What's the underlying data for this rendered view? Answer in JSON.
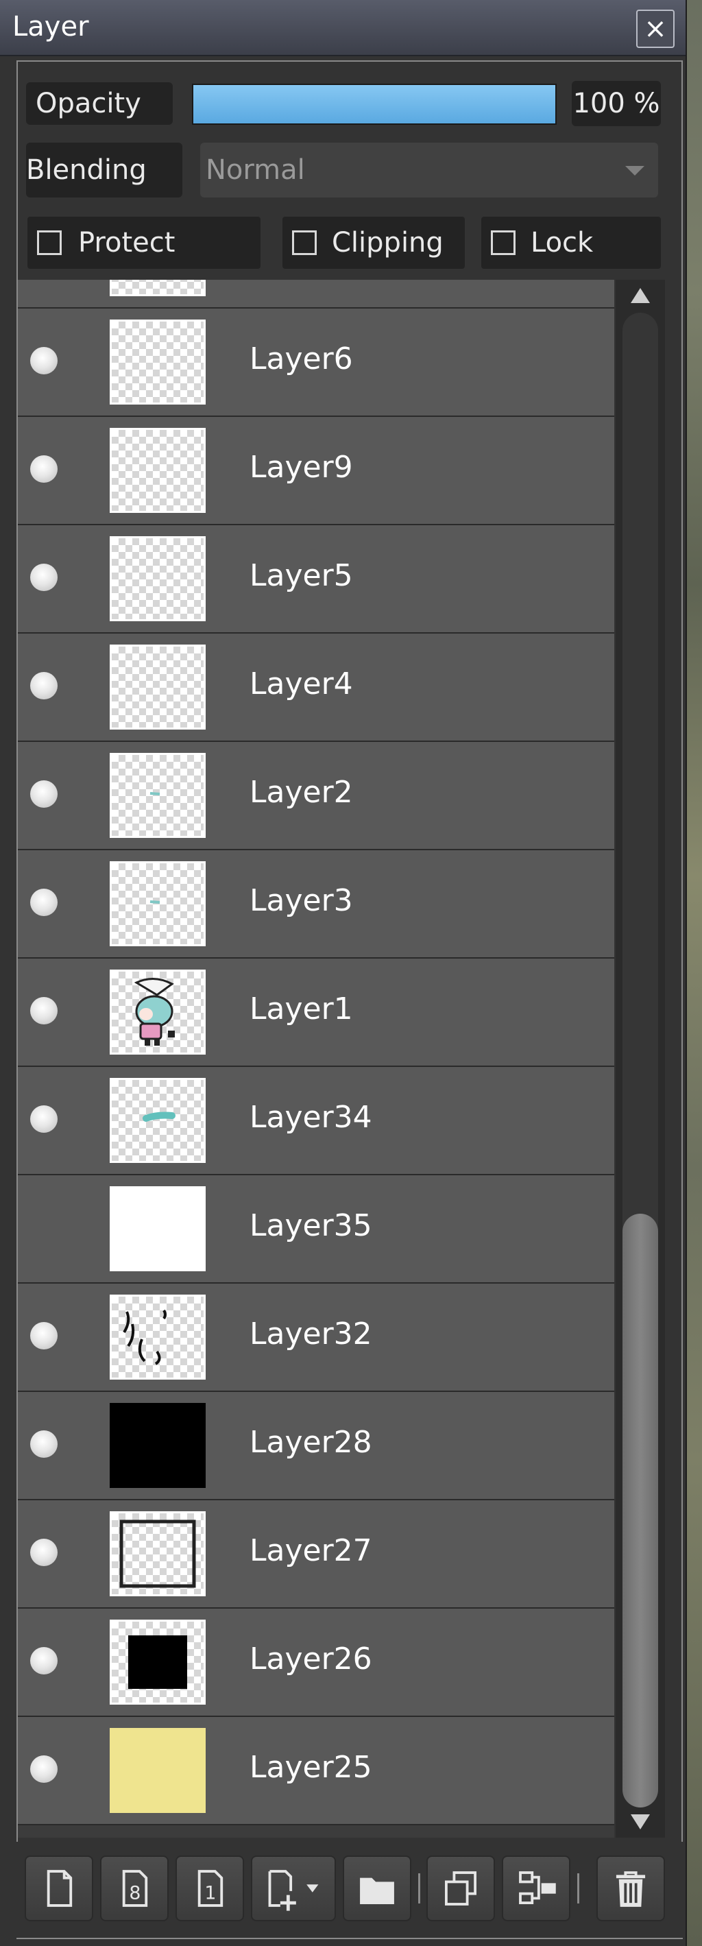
{
  "panel": {
    "title": "Layer",
    "close_symbol": "×"
  },
  "opacity": {
    "label": "Opacity",
    "value": "100 %",
    "fill_percent": 100
  },
  "blending": {
    "label": "Blending",
    "mode": "Normal"
  },
  "toggles": {
    "protect_alpha": {
      "label": "Protect Alpha",
      "checked": false
    },
    "clipping": {
      "label": "Clipping",
      "checked": false
    },
    "lock": {
      "label": "Lock",
      "checked": false
    }
  },
  "layers": [
    {
      "name": "Layer6",
      "visible": true,
      "thumb": "transparent"
    },
    {
      "name": "Layer9",
      "visible": true,
      "thumb": "transparent"
    },
    {
      "name": "Layer5",
      "visible": true,
      "thumb": "transparent"
    },
    {
      "name": "Layer4",
      "visible": true,
      "thumb": "transparent"
    },
    {
      "name": "Layer2",
      "visible": true,
      "thumb": "teal-dots"
    },
    {
      "name": "Layer3",
      "visible": true,
      "thumb": "teal-dots"
    },
    {
      "name": "Layer1",
      "visible": true,
      "thumb": "character"
    },
    {
      "name": "Layer34",
      "visible": true,
      "thumb": "teal-stroke"
    },
    {
      "name": "Layer35",
      "visible": false,
      "thumb": "white"
    },
    {
      "name": "Layer32",
      "visible": true,
      "thumb": "black-strokes"
    },
    {
      "name": "Layer28",
      "visible": true,
      "thumb": "black"
    },
    {
      "name": "Layer27",
      "visible": true,
      "thumb": "frame"
    },
    {
      "name": "Layer26",
      "visible": true,
      "thumb": "black-square"
    },
    {
      "name": "Layer25",
      "visible": true,
      "thumb": "yellow"
    }
  ],
  "toolbar": {
    "buttons": [
      {
        "icon": "new-layer-icon"
      },
      {
        "icon": "new-8bit-layer-icon"
      },
      {
        "icon": "new-1bit-layer-icon"
      },
      {
        "icon": "add-layer-menu-icon"
      },
      {
        "icon": "folder-icon"
      },
      {
        "icon": "duplicate-layer-icon"
      },
      {
        "icon": "merge-down-icon"
      },
      {
        "icon": "trash-icon"
      }
    ]
  },
  "colors": {
    "opacity_fill": "#6bb6e8",
    "row_bg": "#595959",
    "panel_bg": "#333333"
  }
}
